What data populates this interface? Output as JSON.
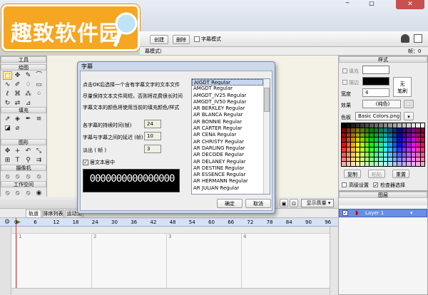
{
  "logo": {
    "text": "趣致软件园"
  },
  "window": {
    "min_icon": "minimize-icon",
    "max_icon": "maximize-icon",
    "close_icon": "close-icon"
  },
  "toolbar": {
    "create": "创建",
    "delete": "删除",
    "subtitle_mode": "字幕模式"
  },
  "infobar": {
    "mode_text": "幕模式）",
    "frame_label": "帧：0"
  },
  "tools": {
    "title": "工具",
    "draw": "绘图",
    "fill": "填充",
    "shape": "图形",
    "camera": "摄像机",
    "workspace": "工作空间"
  },
  "style": {
    "title": "样式",
    "fill": "填充",
    "stroke": "描边",
    "width_label": "宽度",
    "width_value": "4",
    "effect_label": "效果",
    "effect_value": "(纯色)",
    "none_label": "无",
    "none_label2": "笔刷",
    "palette_label": "色板",
    "palette_value": "Basic Colors.png",
    "copy": "复制",
    "paste": "粘贴",
    "reset": "重置",
    "advanced": "高级设置",
    "check_select": "检查器选择"
  },
  "layers": {
    "title": "图层",
    "layer_name": "Layer 1"
  },
  "timeline": {
    "tabs": [
      "轨道",
      "排序列表",
      "运动流"
    ],
    "ticks": [
      "0",
      "6",
      "12",
      "18",
      "24",
      "30",
      "36",
      "42",
      "48",
      "54",
      "60",
      "66",
      "72",
      "78",
      "84",
      "90",
      "96"
    ],
    "markers": [
      "1",
      "2",
      "3",
      "4"
    ],
    "display_quality": "显示质量"
  },
  "dialog": {
    "title": "字幕",
    "line1": "点击OK后选择一个含有字幕文字的文本文件",
    "line2": "尽量保持文本文件简短，否则将花费很长时间",
    "line3": "字幕文本的颜色将使用当前的填充颜色/样式",
    "duration_label": "各字幕的持续时间(帧)",
    "duration_value": "24",
    "gap_label": "字幕与字幕之间的延迟 (帧)",
    "gap_value": "10",
    "fadeout_label": "淡出 ( 帧 )",
    "fadeout_value": "3",
    "center_label": "居文本居中",
    "preview_text": "0000000000000000",
    "ok": "确定",
    "cancel": "取消",
    "fonts": [
      "AIGDT Regular",
      "AMGDT Regular",
      "AMGDT_IV25 Regular",
      "AMGDT_IV50 Regular",
      "AR BERKLEY Regular",
      "AR BLANCA Regular",
      "AR BONNIE Regular",
      "AR CARTER Regular",
      "AR CENA Regular",
      "AR CHRISTY Regular",
      "AR DARLING Regular",
      "AR DECODE Regular",
      "AR DELANEY Regular",
      "AR DESTINE Regular",
      "AR ESSENCE Regular",
      "AR HERMANN Regular",
      "AR JULIAN Regular"
    ]
  }
}
